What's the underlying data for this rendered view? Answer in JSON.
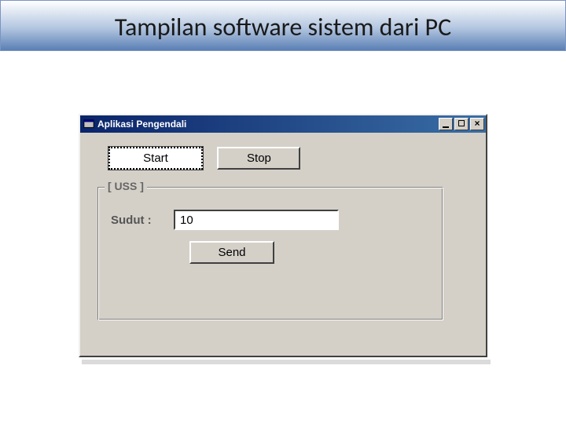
{
  "slide": {
    "title": "Tampilan software sistem dari PC"
  },
  "window": {
    "title": "Aplikasi Pengendali",
    "buttons": {
      "start": "Start",
      "stop": "Stop",
      "send": "Send"
    },
    "frame": {
      "legend": "[ USS ]",
      "sudut_label": "Sudut :",
      "sudut_value": "10"
    }
  }
}
